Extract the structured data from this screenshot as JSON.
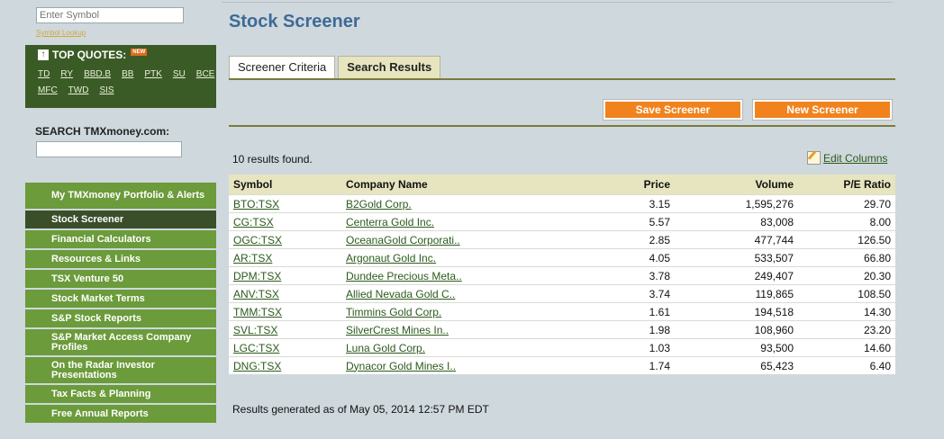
{
  "sidebar": {
    "symbol_placeholder": "Enter Symbol",
    "symbol_lookup": "Symbol Lookup",
    "top_quotes": {
      "title": "TOP QUOTES:",
      "new_badge": "NEW",
      "row1": [
        "TD",
        "RY",
        "BBD.B",
        "BB",
        "PTK",
        "SU",
        "BCE"
      ],
      "row2": [
        "MFC",
        "TWD",
        "SIS"
      ]
    },
    "search_label": "SEARCH TMXmoney.com:",
    "nav": [
      {
        "label": "My TMXmoney Portfolio & Alerts",
        "active": false
      },
      {
        "label": "Stock Screener",
        "active": true
      },
      {
        "label": "Financial Calculators",
        "active": false
      },
      {
        "label": "Resources & Links",
        "active": false
      },
      {
        "label": "TSX Venture 50",
        "active": false
      },
      {
        "label": "Stock Market Terms",
        "active": false
      },
      {
        "label": "S&P Stock Reports",
        "active": false
      },
      {
        "label": "S&P Market Access Company Profiles",
        "active": false
      },
      {
        "label": "On the Radar Investor Presentations",
        "active": false
      },
      {
        "label": "Tax Facts & Planning",
        "active": false
      },
      {
        "label": "Free Annual Reports",
        "active": false
      }
    ]
  },
  "main": {
    "title": "Stock Screener",
    "tabs": [
      {
        "label": "Screener Criteria",
        "active": false
      },
      {
        "label": "Search Results",
        "active": true
      }
    ],
    "save_button": "Save Screener",
    "new_button": "New Screener",
    "results_found": "10 results found.",
    "edit_columns": "Edit Columns",
    "columns": [
      "Symbol",
      "Company Name",
      "Price",
      "Volume",
      "P/E Ratio"
    ],
    "rows": [
      [
        "BTO:TSX",
        "B2Gold Corp.",
        "3.15",
        "1,595,276",
        "29.70"
      ],
      [
        "CG:TSX",
        "Centerra Gold Inc.",
        "5.57",
        "83,008",
        "8.00"
      ],
      [
        "OGC:TSX",
        "OceanaGold Corporati..",
        "2.85",
        "477,744",
        "126.50"
      ],
      [
        "AR:TSX",
        "Argonaut Gold Inc.",
        "4.05",
        "533,507",
        "66.80"
      ],
      [
        "DPM:TSX",
        "Dundee Precious Meta..",
        "3.78",
        "249,407",
        "20.30"
      ],
      [
        "ANV:TSX",
        "Allied Nevada Gold C..",
        "3.74",
        "119,865",
        "108.50"
      ],
      [
        "TMM:TSX",
        "Timmins Gold Corp.",
        "1.61",
        "194,518",
        "14.30"
      ],
      [
        "SVL:TSX",
        "SilverCrest Mines In..",
        "1.98",
        "108,960",
        "23.20"
      ],
      [
        "LGC:TSX",
        "Luna Gold Corp.",
        "1.03",
        "93,500",
        "14.60"
      ],
      [
        "DNG:TSX",
        "Dynacor Gold Mines I..",
        "1.74",
        "65,423",
        "6.40"
      ]
    ],
    "generated": "Results generated as of May 05, 2014 12:57 PM EDT"
  }
}
